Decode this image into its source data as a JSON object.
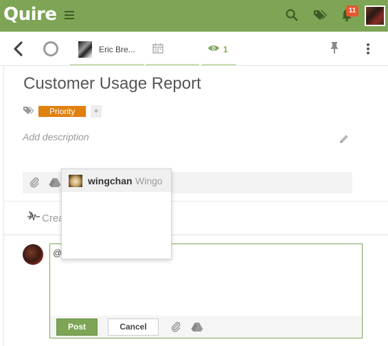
{
  "app": {
    "logo": "Quire",
    "notification_count": "11"
  },
  "icons": {
    "menu": "hamburger-icon",
    "search": "search-icon",
    "tags": "tags-icon",
    "notifications": "bell-icon",
    "back": "chevron-left-icon",
    "complete": "circle-icon",
    "date": "calendar-icon",
    "watch": "eye-icon",
    "pin": "pin-icon",
    "more": "more-vertical-icon",
    "tag": "tag-icon",
    "edit": "pencil-icon",
    "attach": "paperclip-icon",
    "drive": "google-drive-icon",
    "activity": "pulse-icon",
    "expand": "chevron-right-icon"
  },
  "toolbar": {
    "assignee": "Eric Bre...",
    "watchers": "1"
  },
  "task": {
    "title": "Customer Usage Report",
    "tags": [
      {
        "label": "Priority",
        "color": "#e0800e"
      }
    ],
    "add_tag": "+",
    "description_placeholder": "Add description"
  },
  "activity": {
    "label_visible": "Crea"
  },
  "comment": {
    "text": "@",
    "post_label": "Post",
    "cancel_label": "Cancel"
  },
  "mention_dropdown": {
    "items": [
      {
        "username": "wingchan",
        "display_name": "Wingo"
      }
    ]
  },
  "colors": {
    "brand": "#7da555",
    "tag_priority": "#e0800e",
    "badge": "#e4562d"
  }
}
